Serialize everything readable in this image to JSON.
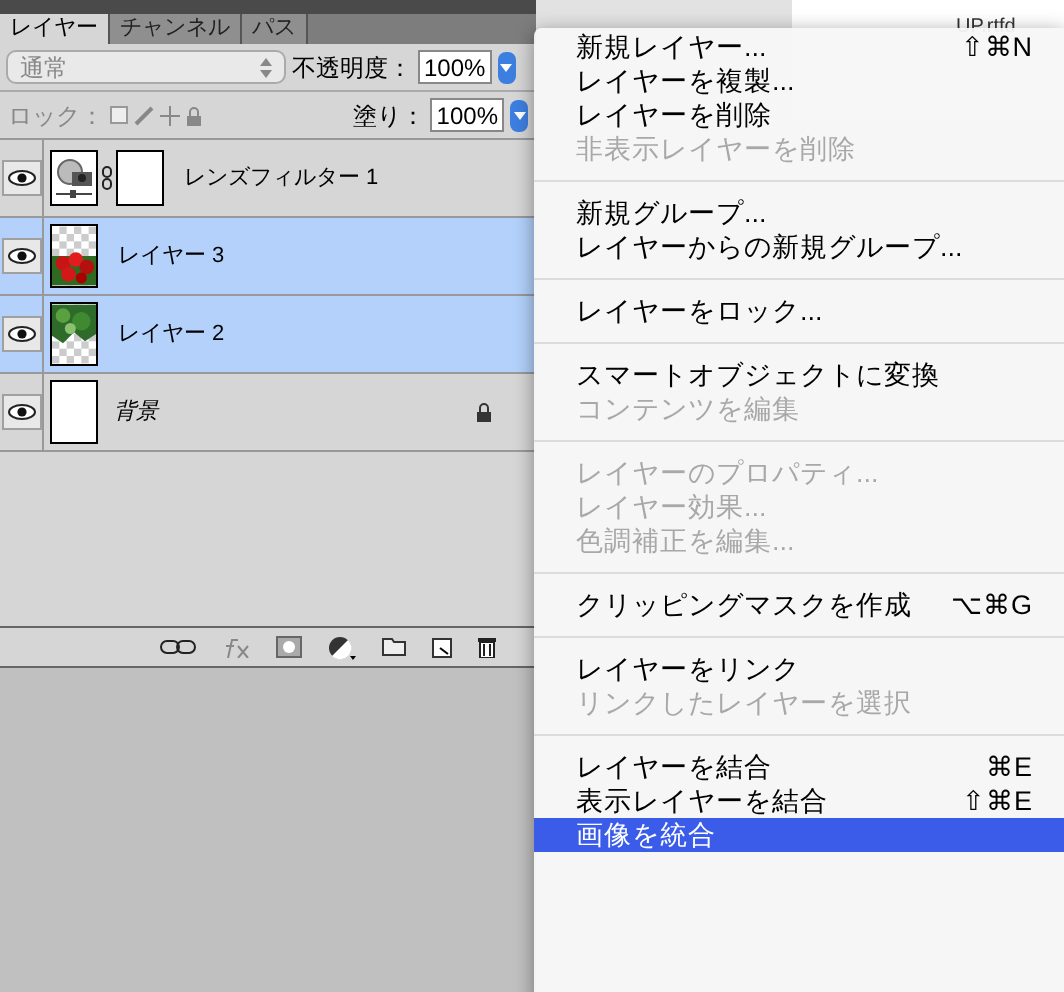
{
  "background_panel": {
    "text": "UP.rtfd"
  },
  "tabs": [
    {
      "label": "レイヤー",
      "selected": true
    },
    {
      "label": "チャンネル",
      "selected": false
    },
    {
      "label": "パス",
      "selected": false
    }
  ],
  "blend_mode": {
    "value": "通常"
  },
  "opacity": {
    "label": "不透明度：",
    "value": "100%"
  },
  "lock": {
    "label": "ロック："
  },
  "fill": {
    "label": "塗り：",
    "value": "100%"
  },
  "layers": [
    {
      "name": "レンズフィルター 1",
      "kind": "adjustment",
      "selected": false,
      "visible": true,
      "locked": false
    },
    {
      "name": "レイヤー 3",
      "kind": "berries",
      "selected": true,
      "visible": true,
      "locked": false
    },
    {
      "name": "レイヤー 2",
      "kind": "leaves",
      "selected": true,
      "visible": true,
      "locked": false
    },
    {
      "name": "背景",
      "kind": "background",
      "selected": false,
      "visible": true,
      "locked": true
    }
  ],
  "menu": [
    {
      "label": "新規レイヤー...",
      "shortcut": "⇧⌘N",
      "disabled": false,
      "selected": false
    },
    {
      "label": "レイヤーを複製...",
      "disabled": false,
      "selected": false
    },
    {
      "label": "レイヤーを削除",
      "disabled": false,
      "selected": false
    },
    {
      "label": "非表示レイヤーを削除",
      "disabled": true,
      "selected": false
    },
    {
      "kind": "separator"
    },
    {
      "label": "新規グループ...",
      "disabled": false,
      "selected": false
    },
    {
      "label": "レイヤーからの新規グループ...",
      "disabled": false,
      "selected": false
    },
    {
      "kind": "separator"
    },
    {
      "label": "レイヤーをロック...",
      "disabled": false,
      "selected": false
    },
    {
      "kind": "separator"
    },
    {
      "label": "スマートオブジェクトに変換",
      "disabled": false,
      "selected": false
    },
    {
      "label": "コンテンツを編集",
      "disabled": true,
      "selected": false
    },
    {
      "kind": "separator"
    },
    {
      "label": "レイヤーのプロパティ...",
      "disabled": true,
      "selected": false
    },
    {
      "label": "レイヤー効果...",
      "disabled": true,
      "selected": false
    },
    {
      "label": "色調補正を編集...",
      "disabled": true,
      "selected": false
    },
    {
      "kind": "separator"
    },
    {
      "label": "クリッピングマスクを作成",
      "shortcut": "⌥⌘G",
      "disabled": false,
      "selected": false
    },
    {
      "kind": "separator"
    },
    {
      "label": "レイヤーをリンク",
      "disabled": false,
      "selected": false
    },
    {
      "label": "リンクしたレイヤーを選択",
      "disabled": true,
      "selected": false
    },
    {
      "kind": "separator"
    },
    {
      "label": "レイヤーを結合",
      "shortcut": "⌘E",
      "disabled": false,
      "selected": false
    },
    {
      "label": "表示レイヤーを結合",
      "shortcut": "⇧⌘E",
      "disabled": false,
      "selected": false
    },
    {
      "label": "画像を統合",
      "disabled": false,
      "selected": true
    }
  ]
}
